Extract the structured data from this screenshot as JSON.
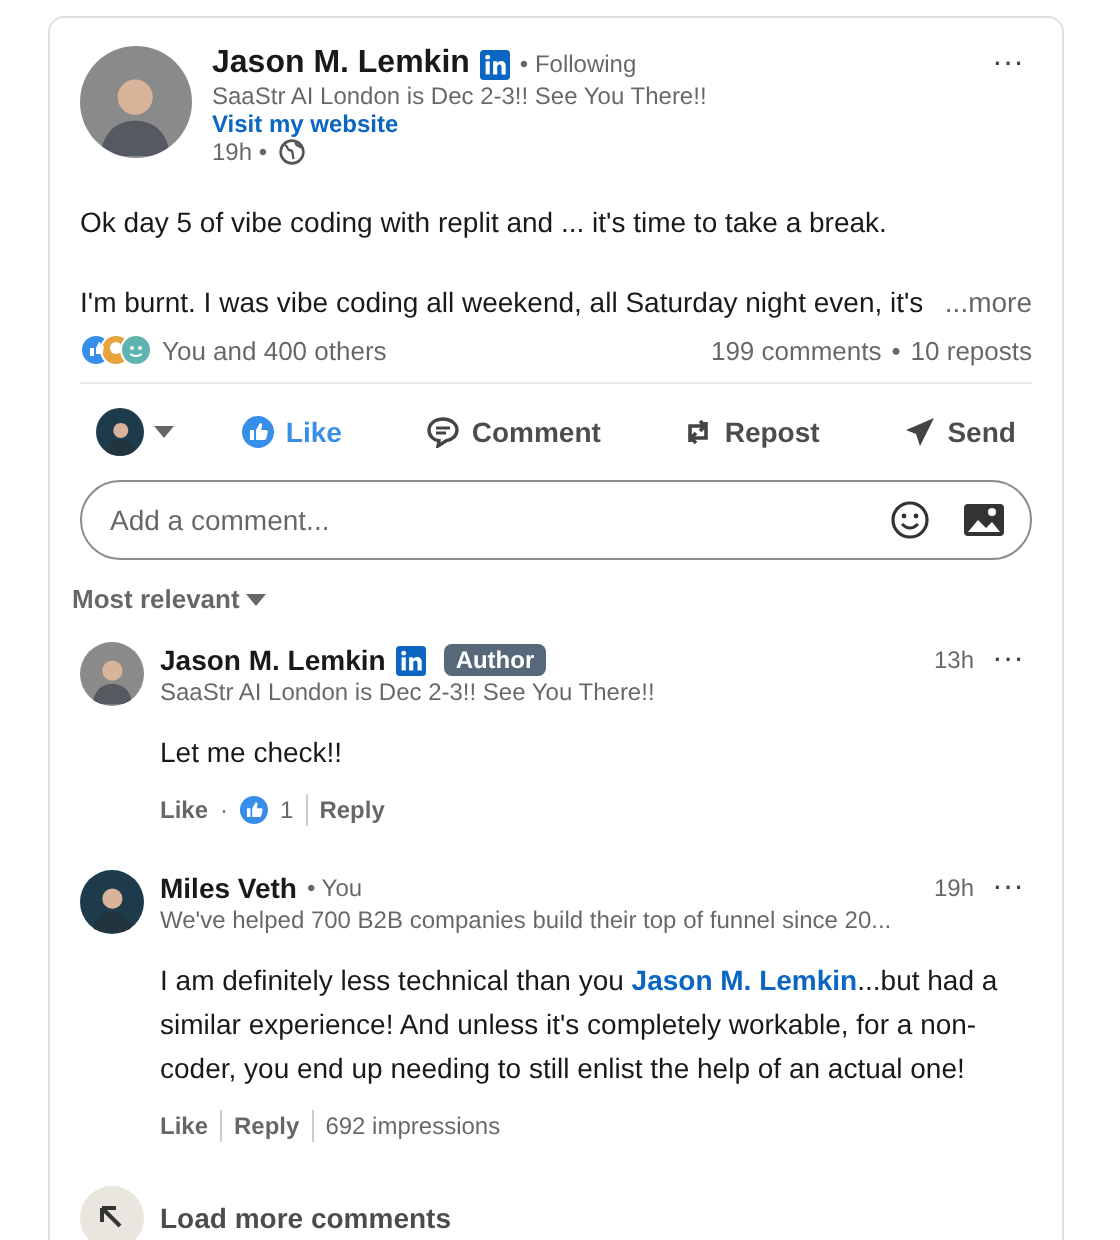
{
  "post": {
    "author": "Jason M. Lemkin",
    "following": "• Following",
    "headline": "SaaStr AI London is Dec 2-3!! See You There!!",
    "website": "Visit my website",
    "time": "19h •",
    "menu": "···",
    "paragraphs": [
      "Ok day 5 of vibe coding with replit and ... it's time to take a break.",
      "I'm burnt. I was vibe coding all weekend, all Saturday night even, it's"
    ],
    "more": "...more",
    "reactions": "You and 400 others",
    "comments": "199 comments",
    "stats_sep": "•",
    "reposts": "10 reposts"
  },
  "actions": [
    {
      "label": "Like",
      "kind": "like",
      "selected": true
    },
    {
      "label": "Comment",
      "kind": "comment",
      "selected": false
    },
    {
      "label": "Repost",
      "kind": "repost",
      "selected": false
    },
    {
      "label": "Send",
      "kind": "send",
      "selected": false
    }
  ],
  "comment_box": {
    "placeholder": "Add a comment..."
  },
  "sort": "Most relevant",
  "comments": [
    {
      "name": "Jason M. Lemkin",
      "badge": "Author",
      "headline": "SaaStr AI London is Dec 2-3!! See You There!!",
      "time": "13h",
      "menu": "···",
      "body": [
        {
          "kind": "text",
          "text": "Let me check!!"
        }
      ],
      "like": "Like",
      "like_sep": "·",
      "like_count": "1",
      "reply": "Reply"
    },
    {
      "name": "Miles Veth",
      "you": "• You",
      "headline": "We've helped 700 B2B companies build their top of funnel since 20...",
      "time": "19h",
      "menu": "···",
      "body": [
        {
          "kind": "text",
          "text": "I am definitely less technical than you "
        },
        {
          "kind": "mention",
          "text": "Jason M. Lemkin"
        },
        {
          "kind": "text",
          "text": "...but had a similar experience! And unless it's completely workable, for a non-coder, you end up needing to still enlist the help of an actual one!"
        }
      ],
      "like": "Like",
      "reply": "Reply",
      "impressions": "692 impressions"
    }
  ],
  "load_more": "Load more comments"
}
